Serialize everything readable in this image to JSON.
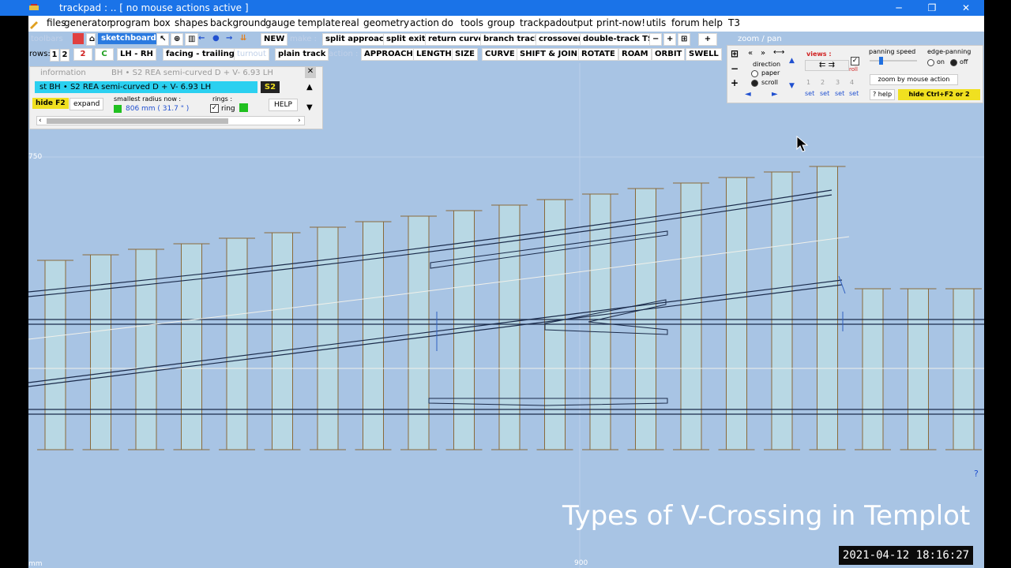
{
  "window": {
    "title": "trackpad :  ..  [ no mouse actions active ]",
    "minimize": "─",
    "restore": "❐",
    "close": "✕"
  },
  "menu": [
    "files",
    "generator",
    "program",
    "box",
    "shapes",
    "background",
    "gauge",
    "template",
    "real",
    "geometry",
    "action",
    "do",
    "tools",
    "group",
    "trackpad",
    "output",
    "print-now!",
    "utils",
    "forum",
    "help",
    "T3"
  ],
  "toolbar1": {
    "toolbars_label": "toolbars",
    "sketchboard": "sketchboard",
    "new": "NEW",
    "make_label": "make :",
    "make_items": [
      "split approach",
      "split exit",
      "return curve",
      "branch track",
      "crossover",
      "double-track TS"
    ],
    "minus": "−",
    "plus": "+"
  },
  "toolbar2": {
    "rows_label": "rows:",
    "row1": "1",
    "row2": "2",
    "num2": "2",
    "c": "C",
    "lhrh": "LH - RH",
    "facing": "facing - trailing",
    "turnout": "turnout",
    "plain": "plain track",
    "action_label": "action :",
    "action_items": [
      "APPROACH",
      "LENGTH",
      "SIZE",
      "CURVE",
      "SHIFT & JOIN",
      "ROTATE",
      "ROAM",
      "ORBIT",
      "SWELL"
    ]
  },
  "info": {
    "header": "information",
    "header_detail": "BH • S2  REA semi-curved  D  +  V- 6.93   LH",
    "line": "st   BH • S2  REA semi-curved  D  +  V- 6.93   LH",
    "badge": "S2",
    "hide": "hide F2",
    "expand": "expand",
    "radius_label": "smallest radius now :",
    "radius_value": "806 mm ( 31.7 \" )",
    "rings_label": "rings :",
    "ring": "ring",
    "help": "HELP"
  },
  "views": {
    "zoom_pan": "zoom  /  pan",
    "direction": "direction",
    "paper": "paper",
    "scroll": "scroll",
    "views_label": "views :",
    "roll": "roll",
    "nums": [
      "1",
      "2",
      "3",
      "4"
    ],
    "set": "set",
    "panning_speed": "panning speed",
    "edge_panning": "edge-panning",
    "on": "on",
    "off": "off",
    "zoom_by_mouse": "zoom by mouse action",
    "help": "? help",
    "hide": "hide  Ctrl+F2  or  2"
  },
  "ruler": {
    "y750": "750",
    "x900": "900",
    "mm": "mm"
  },
  "caption": "Types of V-Crossing in Templot",
  "timestamp": "2021-04-12  18:16:27",
  "question": "?",
  "colors": {
    "canvas": "#a8c4e4",
    "sleeper_fill": "#b8d8e4",
    "sleeper_stroke": "#8a6a3a",
    "rail": "#1a2a4a",
    "title_blue": "#1a73e8"
  }
}
